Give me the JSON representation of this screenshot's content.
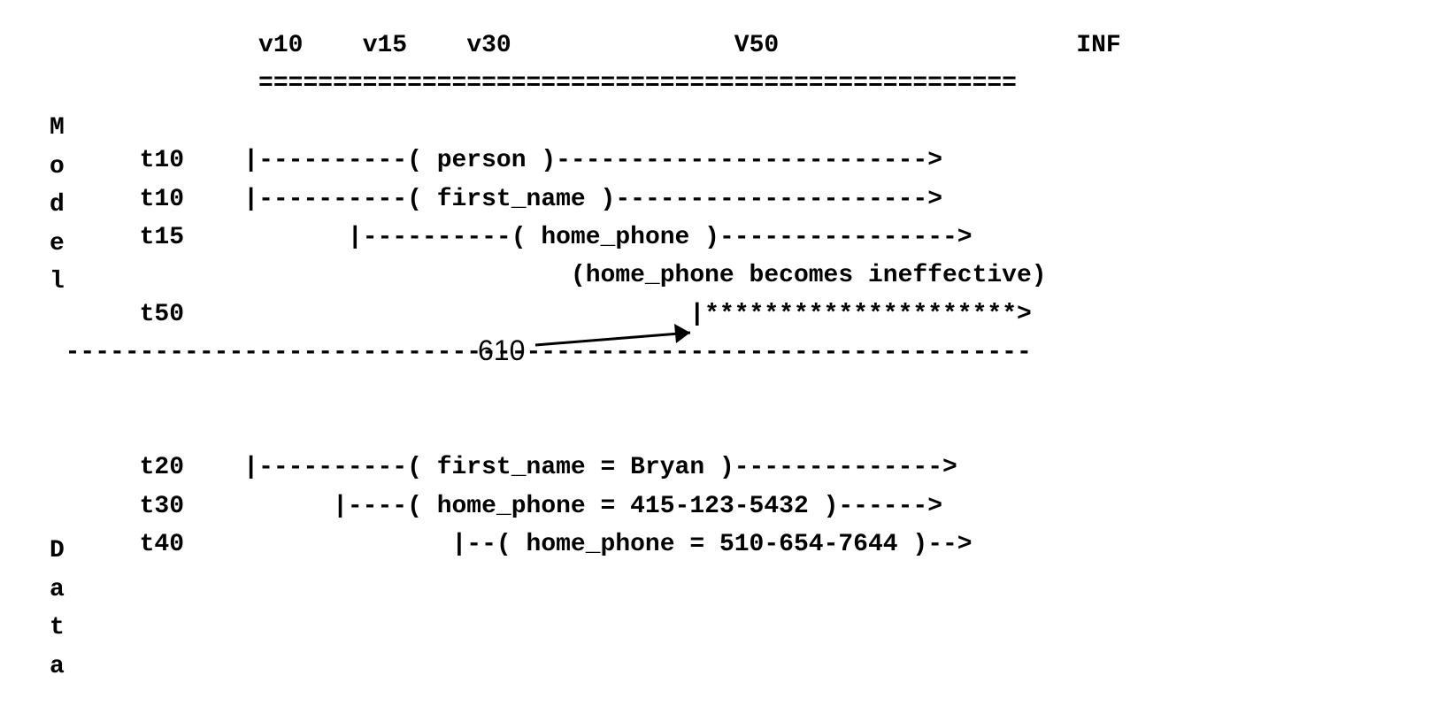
{
  "axis": {
    "v10": "v10",
    "v15": "v15",
    "v30": "v30",
    "v50": "V50",
    "inf": "INF"
  },
  "sections": {
    "model_label": "Model",
    "data_label": "Data"
  },
  "model": {
    "t10_person_t": "t10",
    "t10_person_line": "|----------( person )------------------------->",
    "t10_first_t": "t10",
    "t10_first_line": "|----------( first_name )--------------------->",
    "t15_t": "t15",
    "t15_line": "|----------( home_phone )---------------->",
    "ineffective_note": "(home_phone becomes ineffective)",
    "t50_t": "t50",
    "t50_line": "|*********************>"
  },
  "callout": {
    "num": "610"
  },
  "data": {
    "t20_t": "t20",
    "t20_line": "|----------( first_name = Bryan )-------------->",
    "t30_t": "t30",
    "t30_line": "|----( home_phone = 415-123-5432 )------>",
    "t40_t": "t40",
    "t40_line": "|--( home_phone = 510-654-7644 )-->"
  },
  "dividers": {
    "axis_bar": "===================================================",
    "mid_bar": "-----------------------------------------------------------------"
  }
}
